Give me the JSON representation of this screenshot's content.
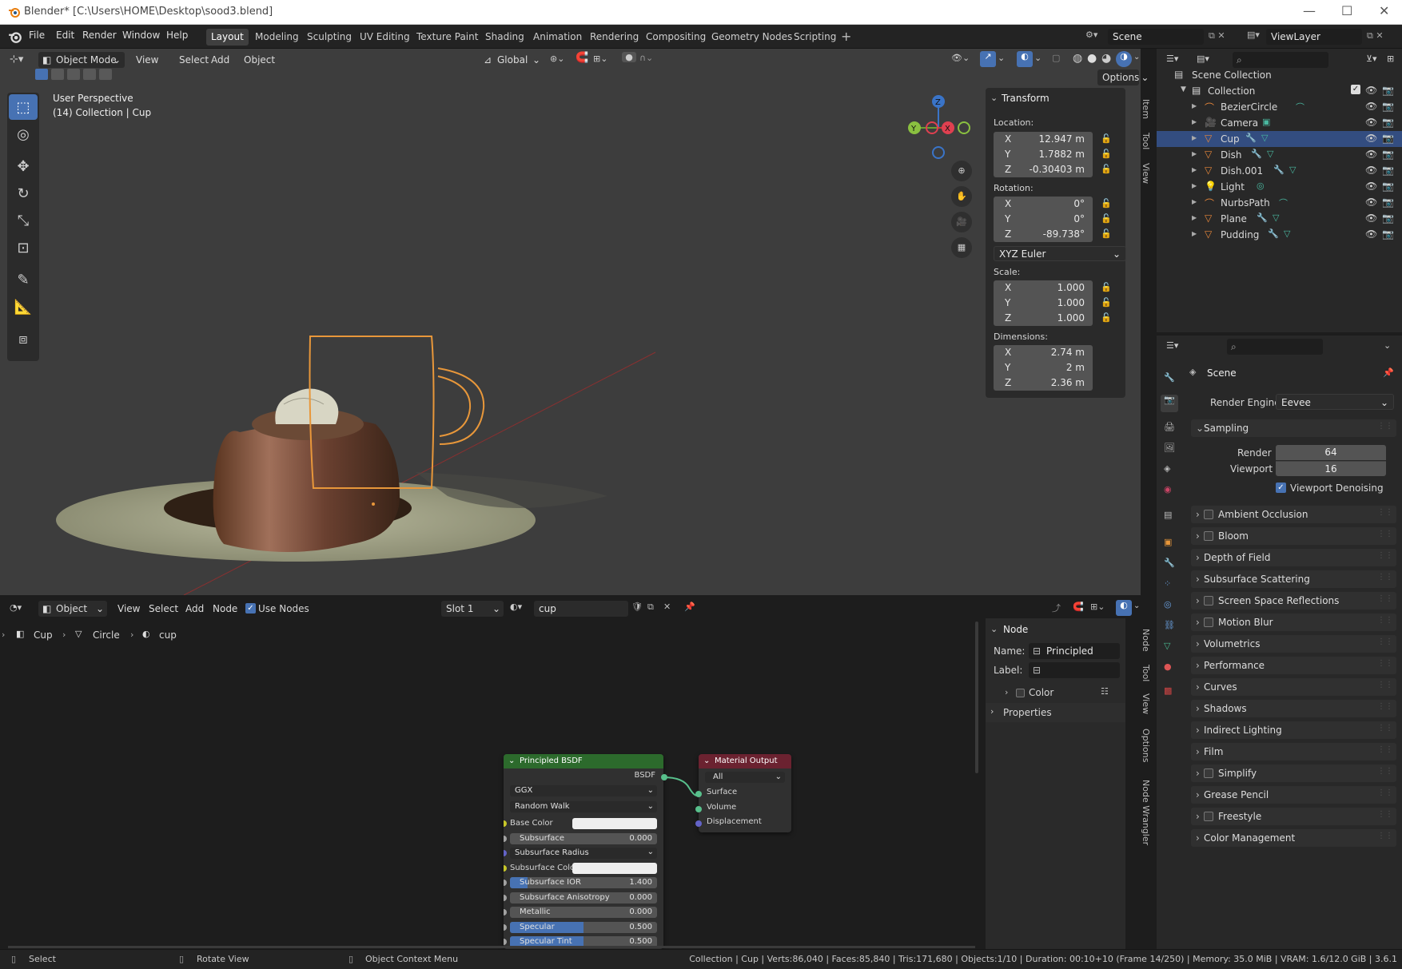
{
  "window": {
    "title": "Blender* [C:\\Users\\HOME\\Desktop\\sood3.blend]",
    "controls": [
      "—",
      "☐",
      "✕"
    ]
  },
  "menu": [
    "File",
    "Edit",
    "Render",
    "Window",
    "Help"
  ],
  "workspaces": [
    "Layout",
    "Modeling",
    "Sculpting",
    "UV Editing",
    "Texture Paint",
    "Shading",
    "Animation",
    "Rendering",
    "Compositing",
    "Geometry Nodes",
    "Scripting"
  ],
  "active_workspace": "Layout",
  "scene_field": "Scene",
  "viewlayer_field": "ViewLayer",
  "viewport": {
    "mode": "Object Mode",
    "menus": [
      "View",
      "Select",
      "Add",
      "Object"
    ],
    "transform_orientation": "Global",
    "options_label": "Options",
    "overlay_title": "User Perspective",
    "overlay_sub": "(14) Collection | Cup",
    "gizmo": {
      "x": "X",
      "y": "Y",
      "z": "Z"
    }
  },
  "npanel": {
    "title": "Transform",
    "location_label": "Location:",
    "location": [
      {
        "ax": "X",
        "v": "12.947 m"
      },
      {
        "ax": "Y",
        "v": "1.7882 m"
      },
      {
        "ax": "Z",
        "v": "-0.30403 m"
      }
    ],
    "rotation_label": "Rotation:",
    "rotation": [
      {
        "ax": "X",
        "v": "0°"
      },
      {
        "ax": "Y",
        "v": "0°"
      },
      {
        "ax": "Z",
        "v": "-89.738°"
      }
    ],
    "rotation_mode": "XYZ Euler",
    "scale_label": "Scale:",
    "scale": [
      {
        "ax": "X",
        "v": "1.000"
      },
      {
        "ax": "Y",
        "v": "1.000"
      },
      {
        "ax": "Z",
        "v": "1.000"
      }
    ],
    "dimensions_label": "Dimensions:",
    "dimensions": [
      {
        "ax": "X",
        "v": "2.74 m"
      },
      {
        "ax": "Y",
        "v": "2 m"
      },
      {
        "ax": "Z",
        "v": "2.36 m"
      }
    ],
    "tabs": [
      "Item",
      "Tool",
      "View"
    ]
  },
  "outliner": {
    "scene_collection": "Scene Collection",
    "collection": "Collection",
    "items": [
      {
        "name": "BezierCircle",
        "color": "#e8873a",
        "selected": false
      },
      {
        "name": "Camera",
        "color": "#e8873a",
        "selected": false
      },
      {
        "name": "Cup",
        "color": "#e8873a",
        "selected": true
      },
      {
        "name": "Dish",
        "color": "#e8873a",
        "selected": false
      },
      {
        "name": "Dish.001",
        "color": "#e8873a",
        "selected": false
      },
      {
        "name": "Light",
        "color": "#e8873a",
        "selected": false
      },
      {
        "name": "NurbsPath",
        "color": "#e8873a",
        "selected": false
      },
      {
        "name": "Plane",
        "color": "#e8873a",
        "selected": false
      },
      {
        "name": "Pudding",
        "color": "#e8873a",
        "selected": false
      }
    ]
  },
  "properties": {
    "context": "Scene",
    "render_engine_label": "Render Engine",
    "render_engine": "Eevee",
    "sampling_label": "Sampling",
    "render_label": "Render",
    "render_value": "64",
    "viewport_label": "Viewport",
    "viewport_value": "16",
    "denoise_label": "Viewport Denoising",
    "sections": [
      {
        "label": "Ambient Occlusion",
        "checkbox": true
      },
      {
        "label": "Bloom",
        "checkbox": true
      },
      {
        "label": "Depth of Field",
        "checkbox": false
      },
      {
        "label": "Subsurface Scattering",
        "checkbox": false
      },
      {
        "label": "Screen Space Reflections",
        "checkbox": true
      },
      {
        "label": "Motion Blur",
        "checkbox": true
      },
      {
        "label": "Volumetrics",
        "checkbox": false
      },
      {
        "label": "Performance",
        "checkbox": false
      },
      {
        "label": "Curves",
        "checkbox": false
      },
      {
        "label": "Shadows",
        "checkbox": false
      },
      {
        "label": "Indirect Lighting",
        "checkbox": false
      },
      {
        "label": "Film",
        "checkbox": false
      },
      {
        "label": "Simplify",
        "checkbox": true
      },
      {
        "label": "Grease Pencil",
        "checkbox": false
      },
      {
        "label": "Freestyle",
        "checkbox": true
      },
      {
        "label": "Color Management",
        "checkbox": false
      }
    ]
  },
  "node_editor": {
    "mode": "Object",
    "menus": [
      "View",
      "Select",
      "Add",
      "Node"
    ],
    "use_nodes": "Use Nodes",
    "slot": "Slot 1",
    "material": "cup",
    "breadcrumb": [
      "Cup",
      "Circle",
      "cup"
    ],
    "npanel": {
      "title": "Node",
      "name_label": "Name:",
      "name_value": "Principled BSDF",
      "label_label": "Label:",
      "color_label": "Color",
      "properties_label": "Properties",
      "tabs": [
        "Node",
        "Tool",
        "View",
        "Options",
        "Node Wrangler"
      ]
    },
    "bsdf": {
      "title": "Principled BSDF",
      "output": "BSDF",
      "distribution": "GGX",
      "ss_method": "Random Walk",
      "rows": [
        {
          "label": "Base Color",
          "value": "",
          "kind": "color"
        },
        {
          "label": "Subsurface",
          "value": "0.000",
          "kind": "num"
        },
        {
          "label": "Subsurface Radius",
          "value": "",
          "kind": "drop"
        },
        {
          "label": "Subsurface Color",
          "value": "",
          "kind": "color"
        },
        {
          "label": "Subsurface IOR",
          "value": "1.400",
          "kind": "num"
        },
        {
          "label": "Subsurface Anisotropy",
          "value": "0.000",
          "kind": "num"
        },
        {
          "label": "Metallic",
          "value": "0.000",
          "kind": "num"
        },
        {
          "label": "Specular",
          "value": "0.500",
          "kind": "num"
        },
        {
          "label": "Specular Tint",
          "value": "0.500",
          "kind": "num"
        }
      ]
    },
    "output_node": {
      "title": "Material Output",
      "target": "All",
      "inputs": [
        "Surface",
        "Volume",
        "Displacement"
      ]
    }
  },
  "status": {
    "left": [
      {
        "icon": "mouse-left-icon",
        "label": "Select"
      },
      {
        "icon": "mouse-middle-icon",
        "label": "Rotate View"
      },
      {
        "icon": "mouse-right-icon",
        "label": "Object Context Menu"
      }
    ],
    "right": "Collection | Cup | Verts:86,040 | Faces:85,840 | Tris:171,680 | Objects:1/10 | Duration: 00:10+10 (Frame 14/250) | Memory: 35.0 MiB | VRAM: 1.6/12.0 GiB | 3.6.1"
  },
  "colors": {
    "accent": "#4772b3",
    "selection": "#e8973a",
    "shader_header": "#2c6a2c",
    "output_header": "#6b2230"
  }
}
